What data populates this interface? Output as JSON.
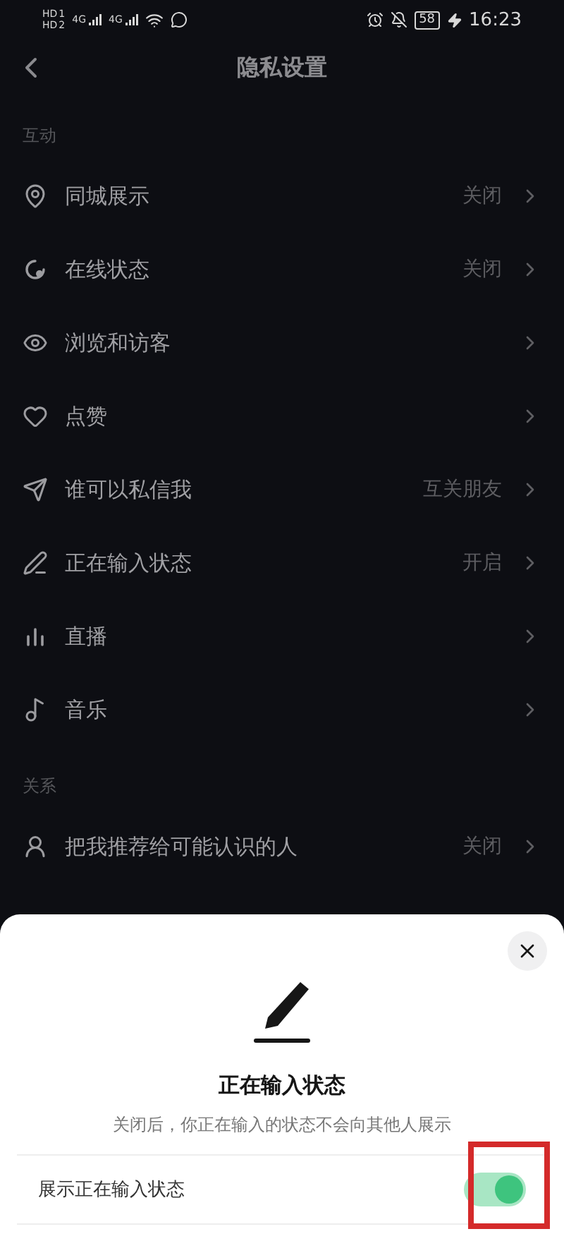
{
  "status_bar": {
    "sims": [
      {
        "badge": "HD",
        "slot": "1",
        "network": "4G"
      },
      {
        "badge": "HD",
        "slot": "2",
        "network": "4G"
      }
    ],
    "battery": "58",
    "charging": true,
    "time": "16:23"
  },
  "header": {
    "title": "隐私设置"
  },
  "sections": [
    {
      "title": "互动",
      "items": [
        {
          "label": "同城展示",
          "value": "关闭"
        },
        {
          "label": "在线状态",
          "value": "关闭"
        },
        {
          "label": "浏览和访客"
        },
        {
          "label": "点赞"
        },
        {
          "label": "谁可以私信我",
          "value": "互关朋友"
        },
        {
          "label": "正在输入状态",
          "value": "开启"
        },
        {
          "label": "直播"
        },
        {
          "label": "音乐"
        }
      ]
    },
    {
      "title": "关系",
      "items": [
        {
          "label": "把我推荐给可能认识的人",
          "value": "关闭"
        }
      ]
    }
  ],
  "sheet": {
    "title": "正在输入状态",
    "description": "关闭后，你正在输入的状态不会向其他人展示",
    "toggle": {
      "label": "展示正在输入状态",
      "on": true,
      "highlighted": true
    }
  }
}
